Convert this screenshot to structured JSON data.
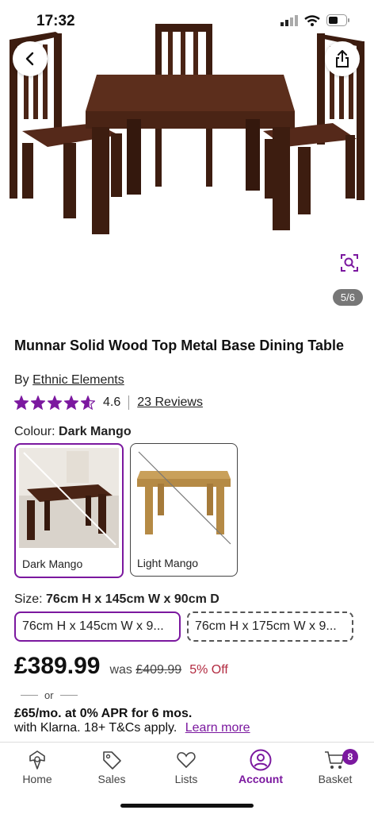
{
  "status": {
    "time": "17:32"
  },
  "gallery": {
    "counter": "5/6"
  },
  "product": {
    "title": "Munnar Solid Wood Top Metal Base Dining Table",
    "by_prefix": "By",
    "brand": "Ethnic Elements",
    "rating": "4.6",
    "rating_value": 4.6,
    "reviews": "23 Reviews"
  },
  "colour": {
    "label": "Colour:",
    "selected": "Dark Mango",
    "options": [
      {
        "label": "Dark Mango"
      },
      {
        "label": "Light Mango"
      }
    ]
  },
  "size": {
    "label": "Size:",
    "selected": "76cm H x 145cm W x 90cm D",
    "options": [
      {
        "label": "76cm H x 145cm W x 9..."
      },
      {
        "label": "76cm H x 175cm W x 9..."
      }
    ]
  },
  "price": {
    "current": "£389.99",
    "was_label": "was",
    "was": "£409.99",
    "discount": "5% Off"
  },
  "finance": {
    "or": "or",
    "line1": "£65/mo. at 0% APR for 6 mos.",
    "line2": "with Klarna. 18+ T&Cs apply.",
    "learn_more": "Learn more"
  },
  "tabs": [
    {
      "label": "Home"
    },
    {
      "label": "Sales"
    },
    {
      "label": "Lists"
    },
    {
      "label": "Account"
    },
    {
      "label": "Basket"
    }
  ],
  "basket_count": "8",
  "colors": {
    "accent": "#7b189f",
    "discount": "#b22a40",
    "wood_dark": "#4a2415",
    "wood_light": "#c9a05a"
  }
}
